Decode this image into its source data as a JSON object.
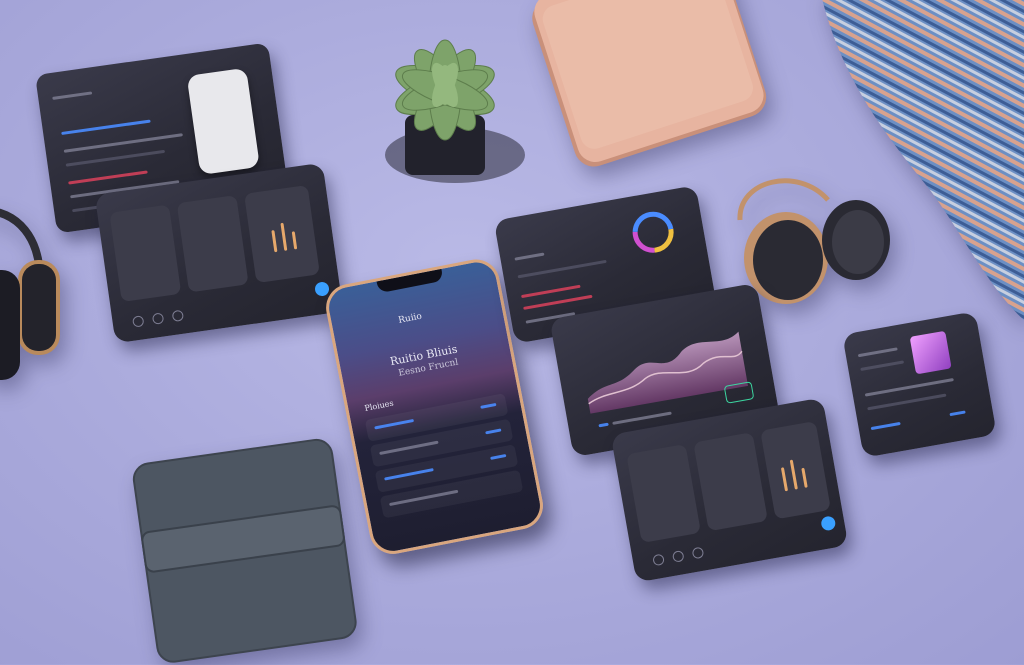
{
  "scene": {
    "background_color": "#aaaadc",
    "objects": [
      "tablet-ui-card",
      "succulent-plant",
      "rose-gold-phone",
      "striped-scarf",
      "headphones-left",
      "headphones-right",
      "smartphone",
      "wallet",
      "analytics-card",
      "chart-card",
      "dashboard-card",
      "small-card"
    ]
  },
  "phone_screen": {
    "header": "Ruiio",
    "title_line_1": "Ruitio Bliuis",
    "title_line_2": "Eesno Frucnl",
    "section_label": "Ploiues"
  },
  "colors": {
    "accent_blue": "#4a8cff",
    "accent_red": "#d0405a",
    "rose_gold": "#e7b4a0",
    "succulent_green": "#7ea36a",
    "wallet_gray": "#4d5662",
    "chart_gradient_start": "#c8a0c8",
    "chart_gradient_end": "#6a3a6a"
  }
}
